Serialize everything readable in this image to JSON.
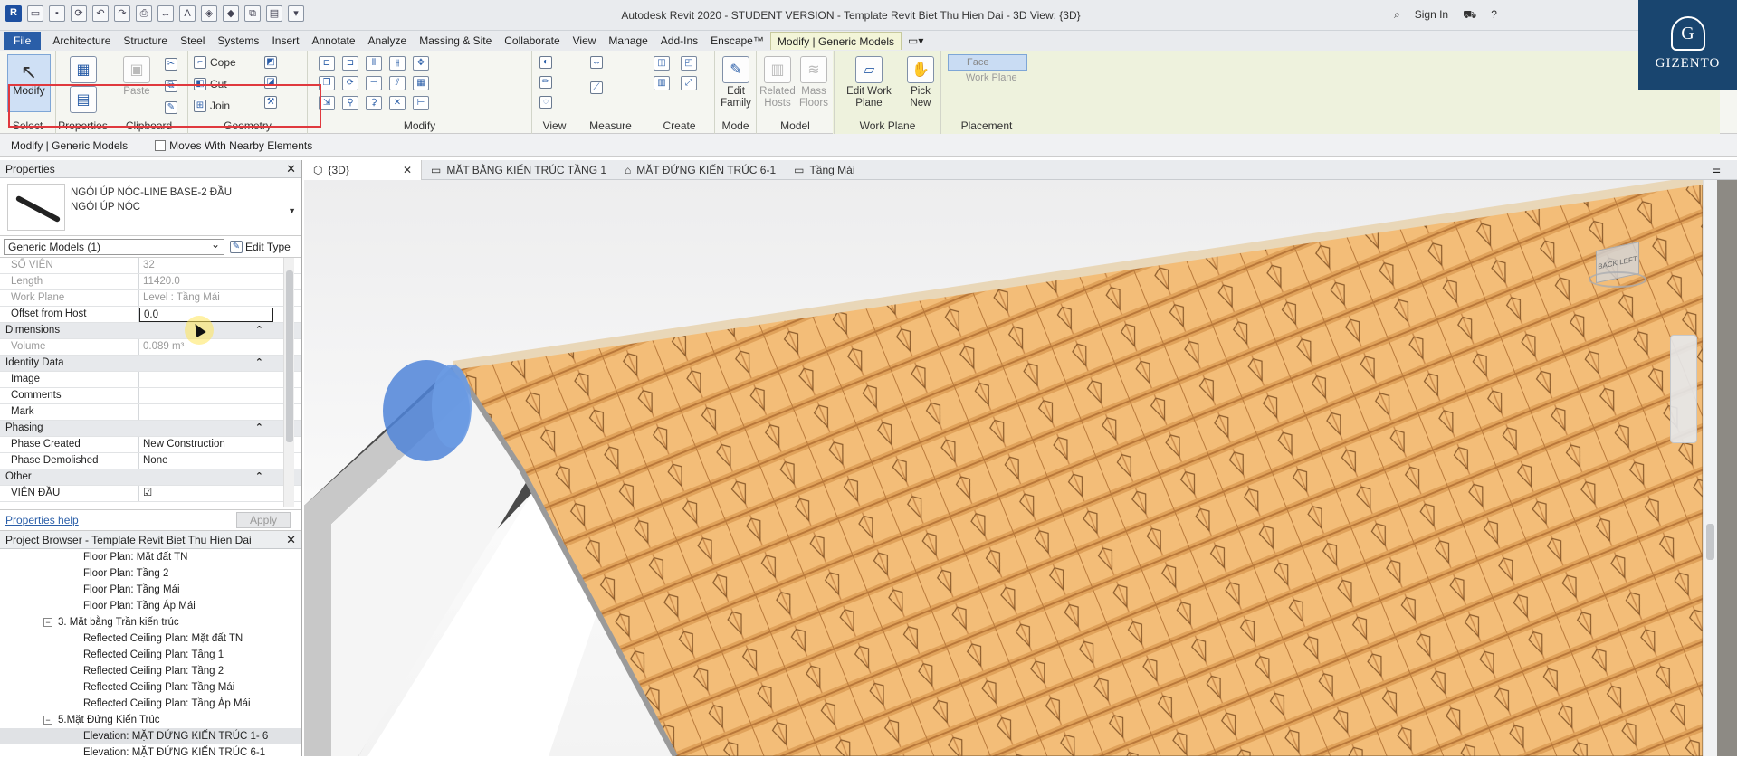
{
  "title": "Autodesk Revit 2020 - STUDENT VERSION - Template Revit Biet Thu Hien Dai - 3D View: {3D}",
  "signin": "Sign In",
  "logo": {
    "letter": "G",
    "word": "GIZENTO"
  },
  "ribbon_tabs": [
    "File",
    "Architecture",
    "Structure",
    "Steel",
    "Systems",
    "Insert",
    "Annotate",
    "Analyze",
    "Massing & Site",
    "Collaborate",
    "View",
    "Manage",
    "Add-Ins",
    "Enscape™",
    "Modify | Generic Models"
  ],
  "ribbon": {
    "modify": "Modify",
    "select": "Select",
    "properties": "Properties",
    "paste": "Paste",
    "clipboard": "Clipboard",
    "cope": "Cope",
    "cut": "Cut",
    "join": "Join",
    "geometry": "Geometry",
    "modify_panel": "Modify",
    "view": "View",
    "measure": "Measure",
    "create": "Create",
    "edit_family": "Edit Family",
    "mode": "Mode",
    "related_hosts": "Related Hosts",
    "mass_floors": "Mass Floors",
    "model": "Model",
    "edit_work_plane": "Edit Work Plane",
    "work_plane": "Work Plane",
    "pick_new": "Pick New",
    "face": "Face",
    "work_plane_opt": "Work Plane",
    "placement": "Placement"
  },
  "options_bar": {
    "context": "Modify | Generic Models",
    "checkbox": "Moves With Nearby Elements"
  },
  "properties": {
    "header": "Properties",
    "type_name_1": "NGÓI ÚP NÓC-LINE BASE-2 ĐẦU",
    "type_name_2": "NGÓI ÚP NÓC",
    "filter": "Generic Models (1)",
    "edit_type": "Edit Type",
    "rows": [
      {
        "k": "SỐ VIÊN",
        "v": "32",
        "kind": "gray"
      },
      {
        "k": "Length",
        "v": "11420.0",
        "kind": "gray"
      },
      {
        "k": "Work Plane",
        "v": "Level : Tầng Mái",
        "kind": "gray"
      },
      {
        "k": "Offset from Host",
        "v": "0.0",
        "kind": "edit"
      },
      {
        "k": "Dimensions",
        "v": "",
        "kind": "grp"
      },
      {
        "k": "Volume",
        "v": "0.089 m³",
        "kind": "gray"
      },
      {
        "k": "Identity Data",
        "v": "",
        "kind": "grp"
      },
      {
        "k": "Image",
        "v": "",
        "kind": "row"
      },
      {
        "k": "Comments",
        "v": "",
        "kind": "row"
      },
      {
        "k": "Mark",
        "v": "",
        "kind": "row"
      },
      {
        "k": "Phasing",
        "v": "",
        "kind": "grp"
      },
      {
        "k": "Phase Created",
        "v": "New Construction",
        "kind": "row"
      },
      {
        "k": "Phase Demolished",
        "v": "None",
        "kind": "row"
      },
      {
        "k": "Other",
        "v": "",
        "kind": "grp"
      },
      {
        "k": "VIÊN ĐẦU",
        "v": "☑",
        "kind": "row"
      }
    ],
    "help": "Properties help",
    "apply": "Apply"
  },
  "project_browser": {
    "header": "Project Browser - Template Revit Biet Thu Hien Dai",
    "items": [
      {
        "label": "Floor Plan: Mặt đất TN",
        "level": 3,
        "toggle": ""
      },
      {
        "label": "Floor Plan: Tầng 2",
        "level": 3,
        "toggle": ""
      },
      {
        "label": "Floor Plan: Tầng Mái",
        "level": 3,
        "toggle": ""
      },
      {
        "label": "Floor Plan: Tầng Áp Mái",
        "level": 3,
        "toggle": ""
      },
      {
        "label": "3. Mặt bằng Trần kiến trúc",
        "level": 2,
        "toggle": "−"
      },
      {
        "label": "Reflected Ceiling Plan: Mặt đất TN",
        "level": 3,
        "toggle": ""
      },
      {
        "label": "Reflected Ceiling Plan: Tầng 1",
        "level": 3,
        "toggle": ""
      },
      {
        "label": "Reflected Ceiling Plan: Tầng 2",
        "level": 3,
        "toggle": ""
      },
      {
        "label": "Reflected Ceiling Plan: Tầng Mái",
        "level": 3,
        "toggle": ""
      },
      {
        "label": "Reflected Ceiling Plan: Tầng Áp Mái",
        "level": 3,
        "toggle": ""
      },
      {
        "label": "5.Mặt Đứng Kiến Trúc",
        "level": 2,
        "toggle": "−"
      },
      {
        "label": "Elevation: MẶT ĐỨNG KIẾN TRÚC 1- 6",
        "level": 3,
        "toggle": "",
        "selected": true
      },
      {
        "label": "Elevation: MẶT ĐỨNG KIẾN TRÚC 6-1",
        "level": 3,
        "toggle": ""
      }
    ]
  },
  "view_tabs": [
    "{3D}",
    "MẶT BẰNG KIẾN TRÚC TẦNG 1",
    "MẶT ĐỨNG KIẾN TRÚC 6-1",
    "Tầng Mái"
  ],
  "viewcube": {
    "back": "BACK",
    "left": "LEFT"
  },
  "colors": {
    "tile": "#f3bd78",
    "tile_dark": "#c7873f",
    "selection": "#4f84d8",
    "file_tab": "#2a5ea8"
  }
}
